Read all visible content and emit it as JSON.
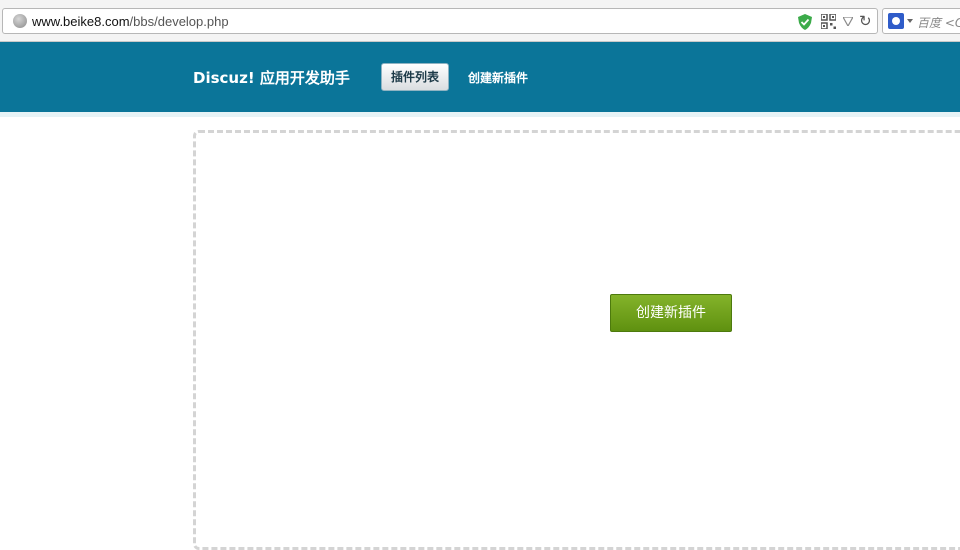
{
  "browser": {
    "url_host": "www.beike8.com",
    "url_path": "/bbs/develop.php",
    "search_placeholder": "百度 <C"
  },
  "header": {
    "app_title": "Discuz! 应用开发助手",
    "tabs": [
      {
        "label": "插件列表",
        "active": true
      },
      {
        "label": "创建新插件",
        "active": false
      }
    ]
  },
  "main": {
    "create_button_label": "创建新插件"
  },
  "colors": {
    "header_bg": "#0b7599",
    "button_green": "#6fa11a"
  }
}
